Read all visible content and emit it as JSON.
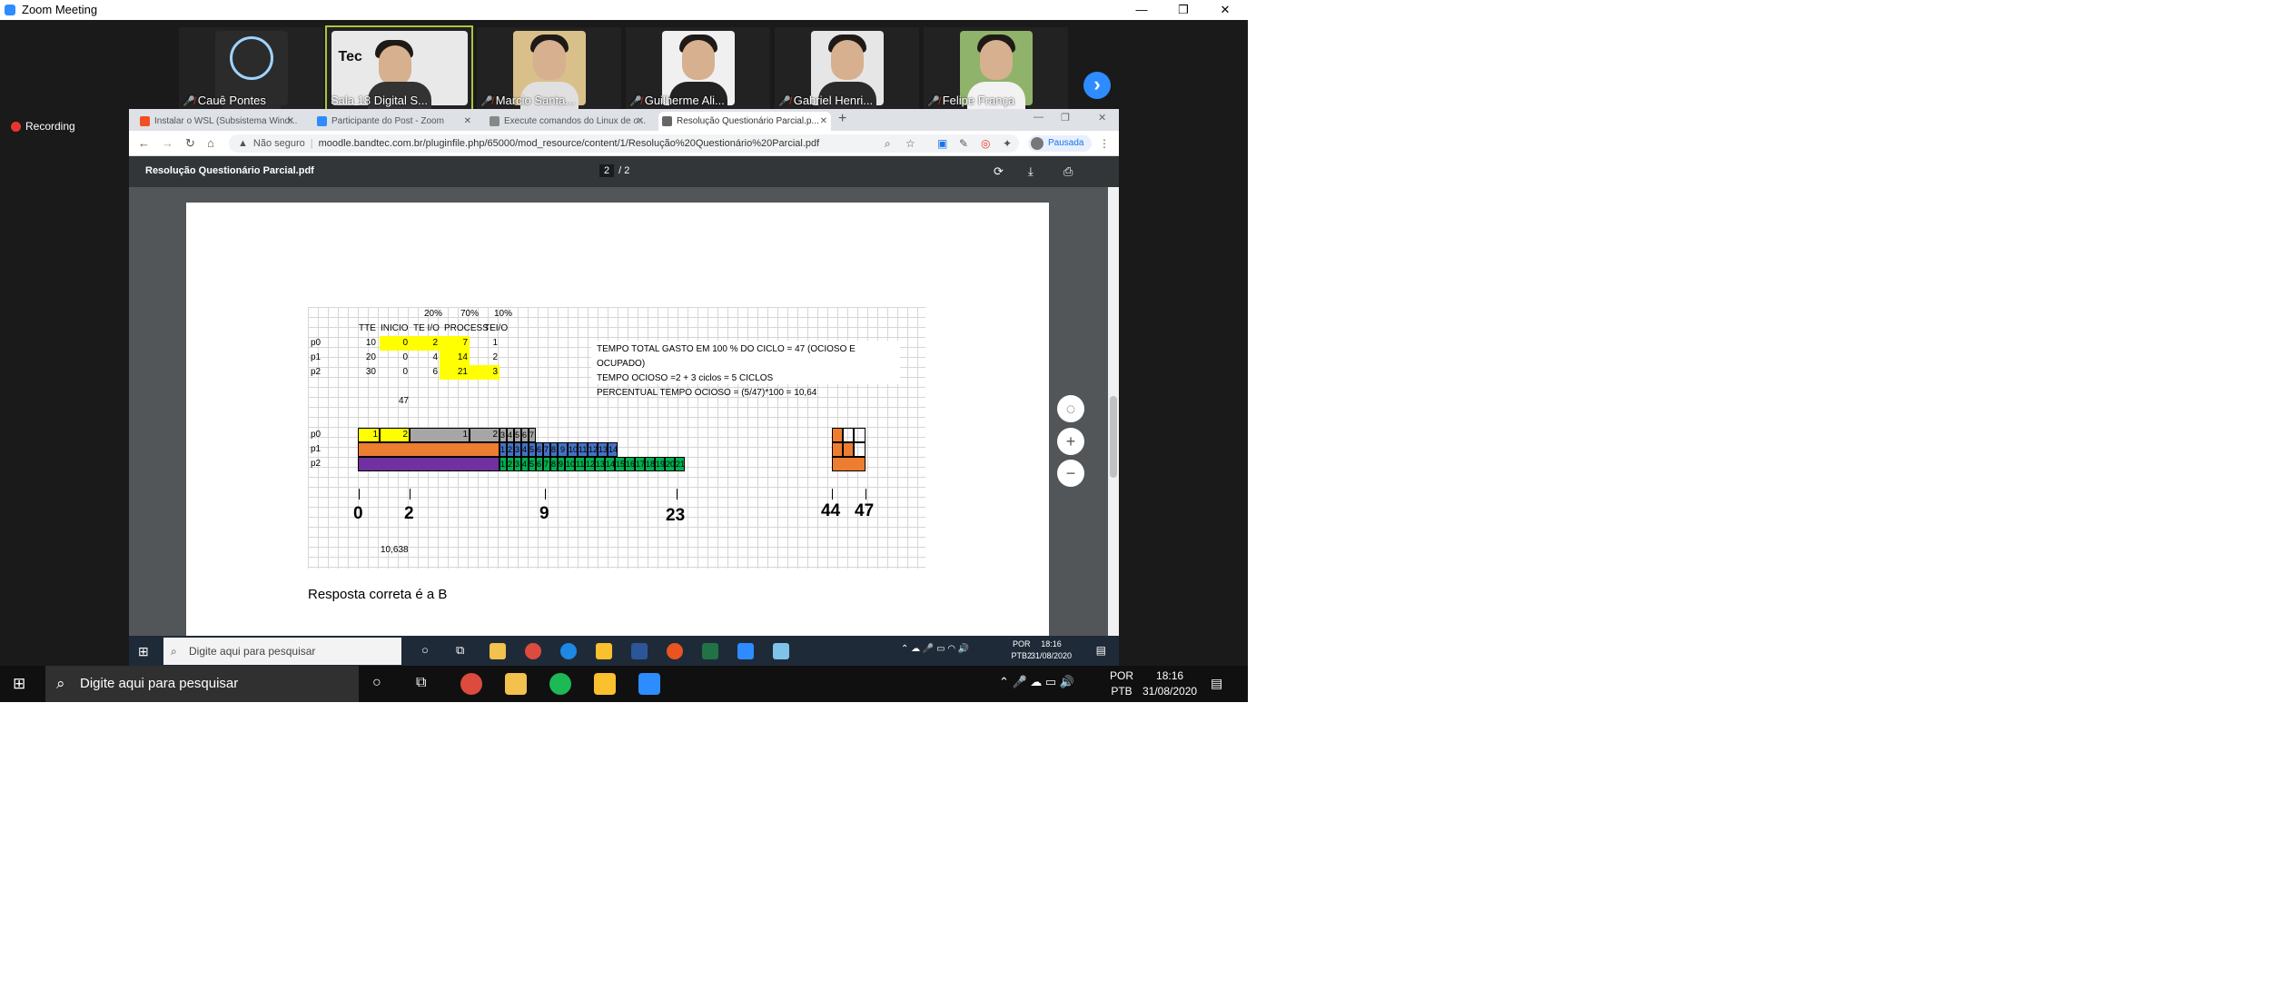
{
  "window": {
    "title": "Zoom Meeting",
    "controls": [
      "—",
      "❐",
      "✕"
    ]
  },
  "participants": [
    {
      "name": "Cauê Pontes",
      "muted": true
    },
    {
      "name": "Sala 18 Digital S...",
      "muted": false,
      "active": true
    },
    {
      "name": "Marcio Santa...",
      "muted": true
    },
    {
      "name": "Guilherme Ali...",
      "muted": true
    },
    {
      "name": "Gabriel Henri...",
      "muted": true
    },
    {
      "name": "Felipe França",
      "muted": true
    }
  ],
  "recording": {
    "label": "Recording"
  },
  "browser": {
    "tabs": [
      {
        "title": "Instalar o WSL (Subsistema Wind..."
      },
      {
        "title": "Participante do Post - Zoom"
      },
      {
        "title": "Execute comandos do Linux de o..."
      },
      {
        "title": "Resolução Questionário Parcial.p...",
        "active": true
      }
    ],
    "new_tab": "+",
    "security": "Não seguro",
    "url": "moodle.bandtec.com.br/pluginfile.php/65000/mod_resource/content/1/Resolução%20Questionário%20Parcial.pdf",
    "profile_status": "Pausada"
  },
  "pdf": {
    "filename": "Resolução Questionário Parcial.pdf",
    "current_page": "2",
    "page_separator": "/",
    "total_pages": "2",
    "header_pct": [
      "20%",
      "70%",
      "10%"
    ],
    "header_cols": [
      "TTE",
      "INICIO",
      "TE I/O",
      "PROCESS",
      "TEI/O"
    ],
    "rows": [
      {
        "proc": "p0",
        "tte": "10",
        "inicio": "0",
        "teio": "2",
        "process": "7",
        "teio2": "1"
      },
      {
        "proc": "p1",
        "tte": "20",
        "inicio": "0",
        "teio": "4",
        "process": "14",
        "teio2": "2"
      },
      {
        "proc": "p2",
        "tte": "30",
        "inicio": "0",
        "teio": "6",
        "process": "21",
        "teio2": "3"
      }
    ],
    "total": "47",
    "notes": [
      "TEMPO TOTAL GASTO EM 100 % DO CICLO = 47 (OCIOSO E OCUPADO)",
      "TEMPO OCIOSO =2 + 3 ciclos  = 5 CICLOS",
      "PERCENTUAL TEMPO OCIOSO = (5/47)*100 =  10,64"
    ],
    "gantt": {
      "p0": {
        "label": "p0",
        "vals": [
          "1",
          "2",
          "1",
          "2",
          "3",
          "4",
          "5",
          "6",
          "7"
        ]
      },
      "p1": {
        "label": "p1",
        "vals": [
          "1",
          "2",
          "3",
          "4",
          "5",
          "6",
          "7",
          "8",
          "9",
          "10",
          "11",
          "12",
          "13",
          "14"
        ]
      },
      "p2": {
        "label": "p2",
        "vals": [
          "1",
          "2",
          "3",
          "4",
          "5",
          "6",
          "7",
          "8",
          "9",
          "10",
          "11",
          "12",
          "13",
          "14",
          "15",
          "16",
          "17",
          "18",
          "19",
          "20",
          "21"
        ]
      }
    },
    "timeline": [
      "0",
      "2",
      "9",
      "23",
      "44",
      "47"
    ],
    "result": "10,638",
    "answer": "Resposta correta é a B"
  },
  "remote_taskbar": {
    "search": "Digite aqui para pesquisar",
    "lang": [
      "POR",
      "PTB2"
    ],
    "time": "18:16",
    "date": "31/08/2020"
  },
  "local_taskbar": {
    "search": "Digite aqui para pesquisar",
    "lang": [
      "POR",
      "PTB"
    ],
    "time": "18:16",
    "date": "31/08/2020"
  },
  "colors": {
    "yellow": "#ffff00",
    "grey": "#a6a6a6",
    "orange": "#ed7d31",
    "purple": "#7030a0",
    "blue": "#4472c4",
    "green": "#00b050",
    "zoom_blue": "#2d8cff"
  }
}
